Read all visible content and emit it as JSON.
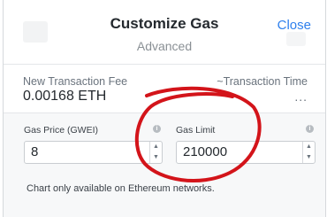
{
  "header": {
    "title": "Customize Gas",
    "subtitle": "Advanced",
    "close_label": "Close"
  },
  "summary": {
    "fee_label": "New Transaction Fee",
    "fee_value": "0.00168 ETH",
    "time_label": "~Transaction Time",
    "time_value": "..."
  },
  "advanced": {
    "gas_price": {
      "label": "Gas Price (GWEI)",
      "value": "8"
    },
    "gas_limit": {
      "label": "Gas Limit",
      "value": "210000"
    },
    "chart_note": "Chart only available on Ethereum networks."
  },
  "icons": {
    "info": "info-icon",
    "stepper_up": "chevron-up-icon",
    "stepper_down": "chevron-down-icon"
  },
  "colors": {
    "accent": "#2f80ed",
    "annotation": "#d3141a"
  }
}
